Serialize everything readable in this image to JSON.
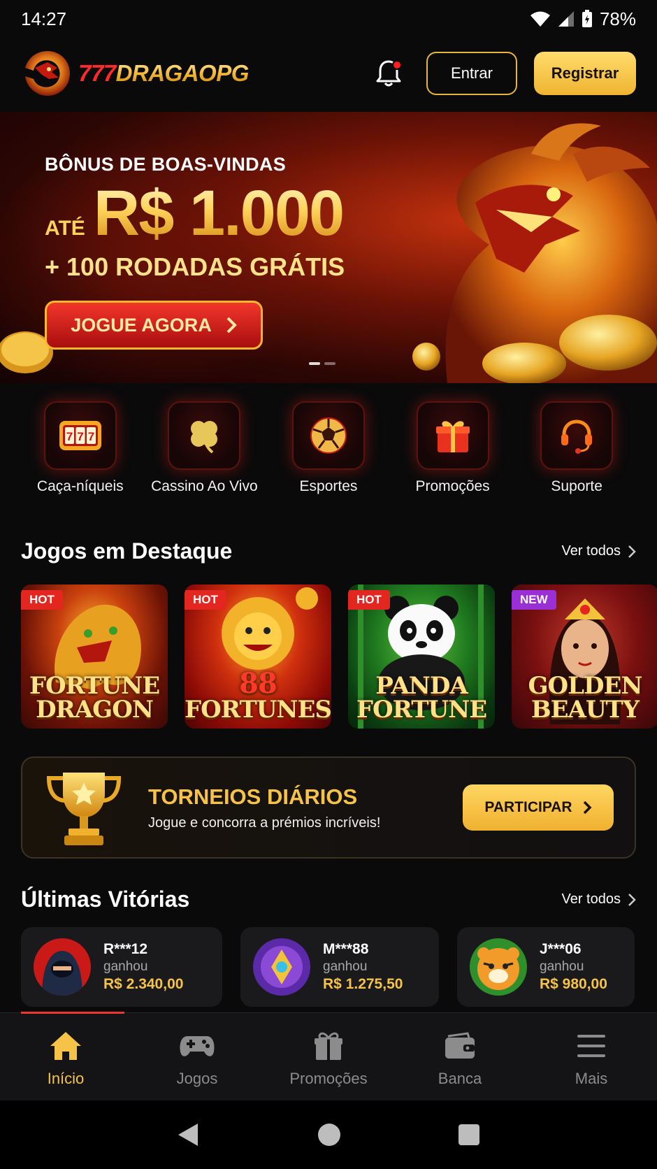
{
  "status_bar": {
    "time": "14:27",
    "battery": "78%"
  },
  "header": {
    "logo_red": "777",
    "logo_gold": "DRAGAOPG",
    "login_label": "Entrar",
    "register_label": "Registrar"
  },
  "banner": {
    "line1": "BÔNUS DE BOAS-VINDAS",
    "prefix": "ATÉ",
    "amount": "R$ 1.000",
    "line3": "+ 100 RODADAS GRÁTIS",
    "cta": "JOGUE AGORA"
  },
  "categories": [
    {
      "label": "Caça-níqueis",
      "icon": "slot-machine-icon"
    },
    {
      "label": "Cassino Ao Vivo",
      "icon": "clover-icon"
    },
    {
      "label": "Esportes",
      "icon": "soccer-ball-icon"
    },
    {
      "label": "Promoções",
      "icon": "gift-icon"
    },
    {
      "label": "Suporte",
      "icon": "headset-icon"
    }
  ],
  "featured": {
    "title": "Jogos em Destaque",
    "see_all": "Ver todos",
    "games": [
      {
        "tag": "HOT",
        "line1": "FORTUNE",
        "line2": "DRAGON"
      },
      {
        "tag": "HOT",
        "line1": "88",
        "line2": "FORTUNES"
      },
      {
        "tag": "HOT",
        "line1": "PANDA",
        "line2": "FORTUNE"
      },
      {
        "tag": "NEW",
        "line1": "GOLDEN",
        "line2": "BEAUTY"
      }
    ]
  },
  "tournament": {
    "title": "TORNEIOS DIÁRIOS",
    "subtitle": "Jogue e concorra a prémios incríveis!",
    "button": "PARTICIPAR"
  },
  "wins": {
    "title": "Últimas Vitórias",
    "see_all": "Ver todos",
    "items": [
      {
        "user": "R***12",
        "action": "ganhou",
        "amount": "R$ 2.340,00"
      },
      {
        "user": "M***88",
        "action": "ganhou",
        "amount": "R$ 1.275,50"
      },
      {
        "user": "J***06",
        "action": "ganhou",
        "amount": "R$ 980,00"
      }
    ]
  },
  "bottom_nav": [
    {
      "label": "Início",
      "icon": "home-icon",
      "active": true
    },
    {
      "label": "Jogos",
      "icon": "gamepad-icon",
      "active": false
    },
    {
      "label": "Promoções",
      "icon": "gift-icon",
      "active": false
    },
    {
      "label": "Banca",
      "icon": "wallet-icon",
      "active": false
    },
    {
      "label": "Mais",
      "icon": "menu-icon",
      "active": false
    }
  ],
  "colors": {
    "accent_gold": "#f6c348",
    "accent_red": "#e3261f",
    "background": "#0a0a0b"
  }
}
